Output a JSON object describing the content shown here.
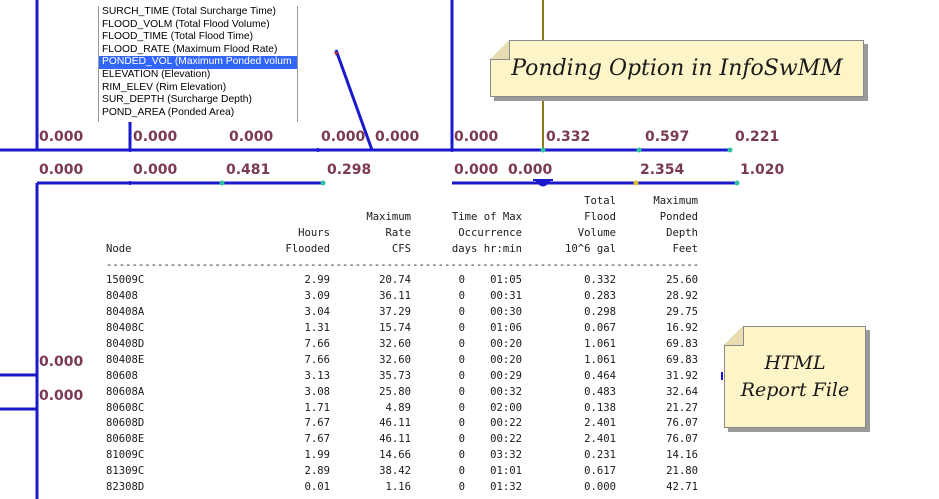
{
  "attribute_list": {
    "items": [
      "SURCH_TIME (Total Surcharge Time)",
      "FLOOD_VOLM (Total Flood Volume)",
      "FLOOD_TIME (Total Flood Time)",
      "FLOOD_RATE (Maximum Flood Rate)",
      "PONDED_VOL (Maximum Ponded volum",
      "ELEVATION (Elevation)",
      "RIM_ELEV (Rim Elevation)",
      "SUR_DEPTH (Surcharge Depth)",
      "POND_AREA (Ponded Area)"
    ],
    "selected_index": 4
  },
  "map_labels": {
    "row1": [
      "0.000",
      "0.000",
      "0.000",
      "0.000",
      "0.000",
      "0.000",
      "0.332",
      "0.597",
      "0.221"
    ],
    "row2": [
      "0.000",
      "0.000",
      "0.481",
      "0.298",
      "0.000",
      "0.000",
      "2.354",
      "1.020"
    ],
    "left_lower": [
      "0.000",
      "0.000"
    ]
  },
  "notes": {
    "ponding": "Ponding Option in InfoSwMM",
    "html_line1": "HTML",
    "html_line2": "Report File"
  },
  "report": {
    "header_lines": [
      {
        "vol": "Total",
        "depth": "Maximum"
      },
      {
        "rate": "Maximum",
        "time": "Time of Max",
        "vol": "Flood",
        "depth": "Ponded"
      },
      {
        "hrs": "Hours",
        "rate": "Rate",
        "time": "Occurrence",
        "vol": "Volume",
        "depth": "Depth"
      },
      {
        "node": "Node",
        "hrs": "Flooded",
        "rate": "CFS",
        "time": "days hr:min",
        "vol": "10^6 gal",
        "depth": "Feet"
      }
    ],
    "separator": "------------------------------------------------------------------------------------------------------",
    "rows": [
      {
        "node": "15009C",
        "hrs": "2.99",
        "rate": "20.74",
        "days": "0",
        "time": "01:05",
        "vol": "0.332",
        "depth": "25.60"
      },
      {
        "node": "80408",
        "hrs": "3.09",
        "rate": "36.11",
        "days": "0",
        "time": "00:31",
        "vol": "0.283",
        "depth": "28.92"
      },
      {
        "node": "80408A",
        "hrs": "3.04",
        "rate": "37.29",
        "days": "0",
        "time": "00:30",
        "vol": "0.298",
        "depth": "29.75"
      },
      {
        "node": "80408C",
        "hrs": "1.31",
        "rate": "15.74",
        "days": "0",
        "time": "01:06",
        "vol": "0.067",
        "depth": "16.92"
      },
      {
        "node": "80408D",
        "hrs": "7.66",
        "rate": "32.60",
        "days": "0",
        "time": "00:20",
        "vol": "1.061",
        "depth": "69.83"
      },
      {
        "node": "80408E",
        "hrs": "7.66",
        "rate": "32.60",
        "days": "0",
        "time": "00:20",
        "vol": "1.061",
        "depth": "69.83"
      },
      {
        "node": "80608",
        "hrs": "3.13",
        "rate": "35.73",
        "days": "0",
        "time": "00:29",
        "vol": "0.464",
        "depth": "31.92"
      },
      {
        "node": "80608A",
        "hrs": "3.08",
        "rate": "25.80",
        "days": "0",
        "time": "00:32",
        "vol": "0.483",
        "depth": "32.64"
      },
      {
        "node": "80608C",
        "hrs": "1.71",
        "rate": "4.89",
        "days": "0",
        "time": "02:00",
        "vol": "0.138",
        "depth": "21.27"
      },
      {
        "node": "80608D",
        "hrs": "7.67",
        "rate": "46.11",
        "days": "0",
        "time": "00:22",
        "vol": "2.401",
        "depth": "76.07"
      },
      {
        "node": "80608E",
        "hrs": "7.67",
        "rate": "46.11",
        "days": "0",
        "time": "00:22",
        "vol": "2.401",
        "depth": "76.07"
      },
      {
        "node": "81009C",
        "hrs": "1.99",
        "rate": "14.66",
        "days": "0",
        "time": "03:32",
        "vol": "0.231",
        "depth": "14.16"
      },
      {
        "node": "81309C",
        "hrs": "2.89",
        "rate": "38.42",
        "days": "0",
        "time": "01:01",
        "vol": "0.617",
        "depth": "21.80"
      },
      {
        "node": "82308D",
        "hrs": "0.01",
        "rate": "1.16",
        "days": "0",
        "time": "01:32",
        "vol": "0.000",
        "depth": "42.71"
      }
    ]
  },
  "colors": {
    "link": "#1a1acc",
    "label": "#7a3a55",
    "selection": "#3366ff",
    "note_bg": "#fdf5c8",
    "olive_line": "#8a7a1a"
  }
}
